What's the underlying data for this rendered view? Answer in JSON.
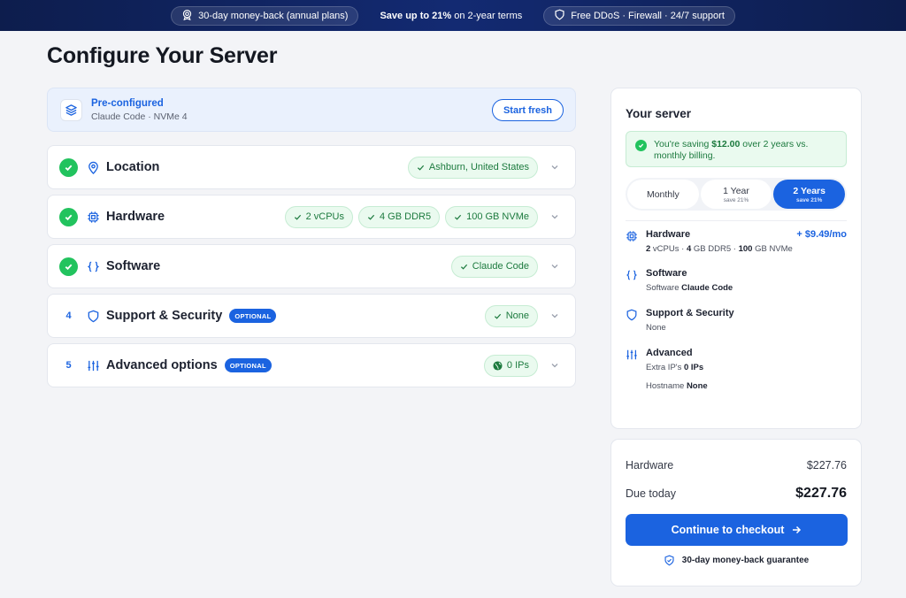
{
  "banner": {
    "left_pill": "30-day money-back (annual plans)",
    "middle_bold": "Save up to 21%",
    "middle_rest": " on 2-year terms",
    "right_pill": "Free DDoS · Firewall · 24/7 support"
  },
  "page_title": "Configure Your Server",
  "preconfigured": {
    "title": "Pre-configured",
    "subtitle": "Claude Code · NVMe 4",
    "button": "Start fresh"
  },
  "sections": [
    {
      "title": "Location",
      "status": "done",
      "icon": "map-pin-icon",
      "chips": [
        "Ashburn, United States"
      ]
    },
    {
      "title": "Hardware",
      "status": "done",
      "icon": "cpu-icon",
      "chips": [
        "2 vCPUs",
        "4 GB DDR5",
        "100 GB NVMe"
      ]
    },
    {
      "title": "Software",
      "status": "done",
      "icon": "braces-icon",
      "chips": [
        "Claude Code"
      ]
    },
    {
      "title": "Support & Security",
      "status": "4",
      "icon": "shield-icon",
      "badge": "OPTIONAL",
      "chips": [
        "None"
      ]
    },
    {
      "title": "Advanced options",
      "status": "5",
      "icon": "sliders-icon",
      "badge": "OPTIONAL",
      "chips": [
        "0 IPs"
      ]
    }
  ],
  "summary": {
    "title": "Your server",
    "saving_pre": "You're saving ",
    "saving_amount": "$12.00",
    "saving_post": " over 2 years vs. monthly billing.",
    "billing_options": [
      {
        "label": "Monthly",
        "sub": ""
      },
      {
        "label": "1 Year",
        "sub": "save 21%"
      },
      {
        "label": "2 Years",
        "sub": "save 21%"
      }
    ],
    "billing_selected": "2 Years",
    "hardware": {
      "title": "Hardware",
      "price": "+ $9.49/mo",
      "cpu_val": "2",
      "cpu_unit": " vCPUs",
      "ram_val": "4",
      "ram_unit": " GB DDR5",
      "disk_val": "100",
      "disk_unit": " GB NVMe"
    },
    "software": {
      "title": "Software",
      "label": "Software ",
      "value": "Claude Code"
    },
    "support": {
      "title": "Support & Security",
      "value": "None"
    },
    "advanced": {
      "title": "Advanced",
      "ip_label": "Extra IP's ",
      "ip_value": "0 IPs",
      "host_label": "Hostname ",
      "host_value": "None"
    }
  },
  "totals": {
    "hardware_label": "Hardware",
    "hardware_value": "$227.76",
    "due_label": "Due today",
    "due_value": "$227.76",
    "checkout": "Continue to checkout",
    "guarantee": "30-day money-back guarantee"
  },
  "colors": {
    "accent": "#1b63e0",
    "success": "#22c35e",
    "success_bg": "#eafaef",
    "banner": "#0d1d4d"
  }
}
